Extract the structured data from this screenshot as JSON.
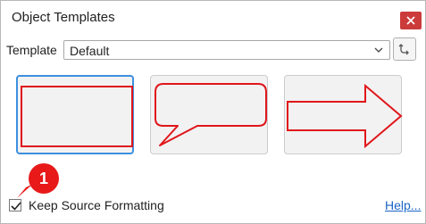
{
  "window": {
    "title": "Object Templates",
    "close_icon": "close-icon"
  },
  "template": {
    "label": "Template",
    "selected": "Default",
    "dropdown_icon": "chevron-down-icon",
    "refresh_icon": "refresh-icon"
  },
  "templates": [
    {
      "name": "rectangle",
      "selected": true
    },
    {
      "name": "speech-bubble",
      "selected": false
    },
    {
      "name": "arrow-right",
      "selected": false
    }
  ],
  "callout": {
    "number": "1"
  },
  "options": {
    "keep_source_formatting_label": "Keep Source Formatting",
    "keep_source_formatting_checked": true
  },
  "footer": {
    "help_label": "Help..."
  },
  "colors": {
    "shape_stroke": "#e0161b",
    "selection": "#3d90e0",
    "close_button": "#cc3b3b",
    "callout": "#e81919",
    "link": "#1a65c7"
  }
}
